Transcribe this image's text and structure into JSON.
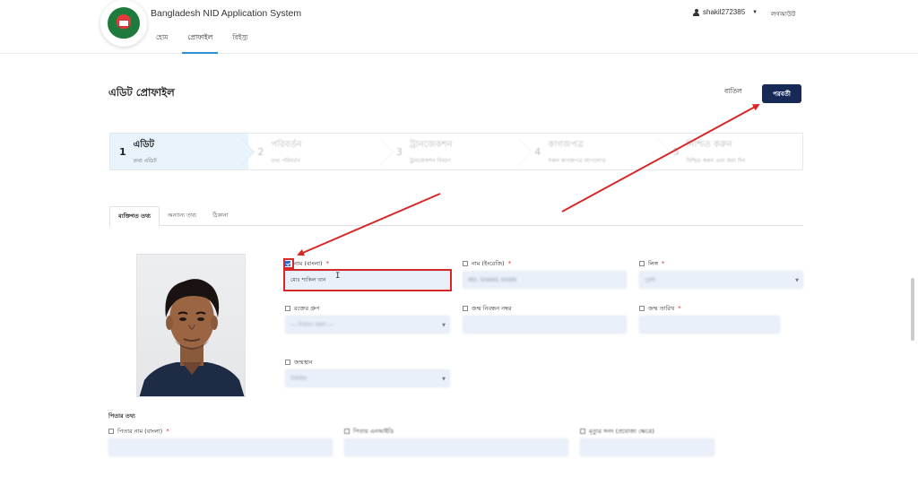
{
  "header": {
    "app_title": "Bangladesh NID Application System",
    "nav": [
      "হোম",
      "প্রোফাইল",
      "রিইস্যু"
    ],
    "active_nav": 1,
    "username": "shakil272385",
    "logout_label": "লগআউট"
  },
  "page": {
    "title": "এডিট প্রোফাইল",
    "cancel_label": "বাতিল",
    "next_label": "পরবর্তী"
  },
  "stepper": [
    {
      "num": "1",
      "title": "এডিট",
      "sub": "তথ্য এডিট"
    },
    {
      "num": "2",
      "title": "পরিবর্তন",
      "sub": "তথ্য পরিবর্তন"
    },
    {
      "num": "3",
      "title": "ট্রানজেকশন",
      "sub": "ট্রানজেকশন বিবরণ"
    },
    {
      "num": "4",
      "title": "কাগজপত্র",
      "sub": "সকল কাগজপত্র আপলোড"
    },
    {
      "num": "5",
      "title": "নিশ্চিত করুন",
      "sub": "নিশ্চিত করুন এবং জমা দিন"
    }
  ],
  "tabs": [
    "ব্যক্তিগত তথ্য",
    "অন্যান্য তথ্য",
    "ঠিকানা"
  ],
  "form": {
    "name_bn": {
      "label": "নাম (বাংলা)",
      "value": "মোঃ শাকিল খান",
      "required": "*"
    },
    "name_en": {
      "label": "নাম (ইংরেজি)",
      "value": "MD. SHAKIL KHAN",
      "required": "*"
    },
    "gender": {
      "label": "লিঙ্গ",
      "value": "পুরুষ",
      "required": "*"
    },
    "blood_group": {
      "label": "রক্তের গ্রুপ",
      "value": "--- নির্বাচন করুন ---"
    },
    "birth_reg": {
      "label": "জন্ম নিবন্ধন নম্বর",
      "value": ""
    },
    "dob": {
      "label": "জন্ম তারিখ",
      "value": "",
      "required": "*"
    },
    "birth_place": {
      "label": "জন্মস্থান",
      "value": "টাঙ্গাইল"
    }
  },
  "father_section": {
    "title": "পিতার তথ্য",
    "name_bn": {
      "label": "পিতার নাম (বাংলা)",
      "required": "*"
    },
    "nid": {
      "label": "পিতার এনআইডি"
    },
    "sonod": {
      "label": "মৃত্যুর সনদ (প্রযোজ্য ক্ষেত্রে)"
    }
  },
  "colors": {
    "primary": "#172a57",
    "accent": "#2b8fd6",
    "annotation": "#d62828"
  }
}
